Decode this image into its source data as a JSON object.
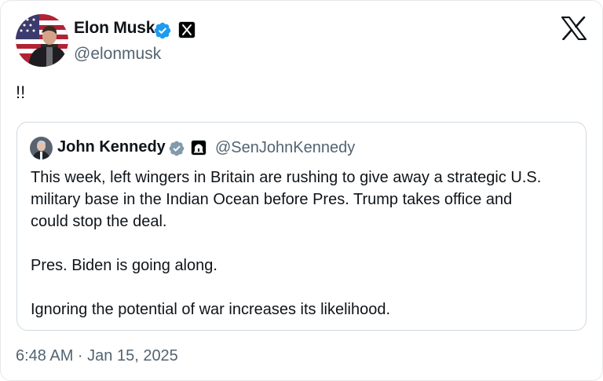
{
  "tweet": {
    "author": {
      "name": "Elon Musk",
      "handle": "@elonmusk",
      "avatar_icon": "flag-portrait-avatar",
      "verified_icon": "blue-verified-badge-icon",
      "affiliation_icon": "x-affiliation-icon",
      "verified_color": "#1d9bf0"
    },
    "text": "!!",
    "timestamp": "6:48 AM · Jan 15, 2025",
    "brand_icon": "x-logo-icon"
  },
  "quoted_tweet": {
    "author": {
      "name": "John Kennedy",
      "handle": "@SenJohnKennedy",
      "avatar_icon": "senator-portrait-avatar",
      "verified_icon": "gray-verified-badge-icon",
      "affiliation_icon": "government-building-icon",
      "verified_color": "#829aab"
    },
    "paragraphs": [
      [
        "This week, left wingers in Britain are rushing to give away a strategic U.S.",
        "military base in the Indian Ocean before Pres. Trump takes office and",
        "could stop the deal."
      ],
      [
        "Pres. Biden is going along."
      ],
      [
        "Ignoring the potential of war increases its likelihood."
      ]
    ]
  },
  "colors": {
    "text_primary": "#0f1419",
    "text_secondary": "#536471",
    "border": "#cfd9de"
  }
}
